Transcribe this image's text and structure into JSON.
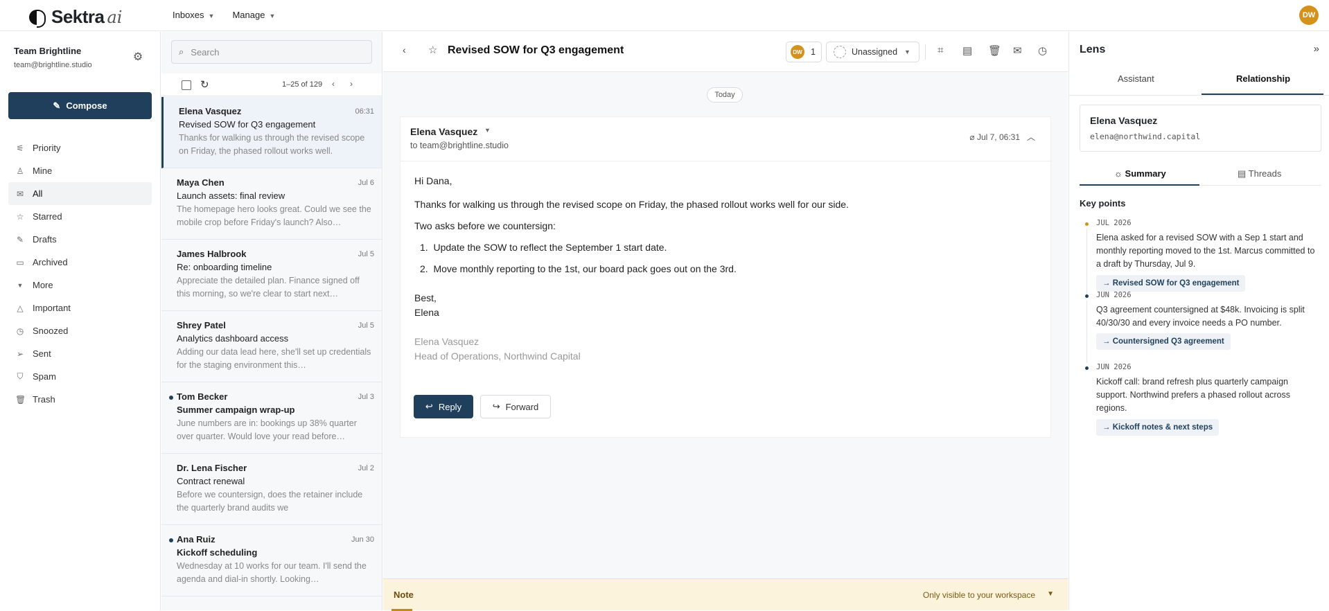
{
  "app": {
    "name": "Sektra",
    "suffix": "ai",
    "avatar_initials": "DW"
  },
  "topnav": [
    {
      "label": "Inboxes"
    },
    {
      "label": "Manage"
    }
  ],
  "sidebar": {
    "team_name": "Team Brightline",
    "team_email": "team@brightline.studio",
    "compose_label": "Compose",
    "items": [
      {
        "label": "Priority",
        "icon": "priority-icon"
      },
      {
        "label": "Mine",
        "icon": "user-icon"
      },
      {
        "label": "All",
        "icon": "mail-icon"
      },
      {
        "label": "Starred",
        "icon": "star-icon"
      },
      {
        "label": "Drafts",
        "icon": "pencil-icon"
      },
      {
        "label": "Archived",
        "icon": "archive-icon"
      }
    ],
    "more_label": "More",
    "more_items": [
      {
        "label": "Important",
        "icon": "important-icon"
      },
      {
        "label": "Snoozed",
        "icon": "clock-icon"
      },
      {
        "label": "Sent",
        "icon": "send-icon"
      },
      {
        "label": "Spam",
        "icon": "shield-icon"
      },
      {
        "label": "Trash",
        "icon": "trash-icon"
      }
    ]
  },
  "list": {
    "search_placeholder": "Search",
    "count": "1–25 of 129",
    "messages": [
      {
        "from": "Elena Vasquez",
        "date": "06:31",
        "subject": "Revised SOW for Q3 engagement",
        "preview": "Thanks for walking us through the revised scope on Friday, the phased rollout works well.",
        "selected": true,
        "unread": false
      },
      {
        "from": "Maya Chen",
        "date": "Jul 6",
        "subject": "Launch assets: final review",
        "preview": "The homepage hero looks great. Could we see the mobile crop before Friday's launch? Also…",
        "selected": false,
        "unread": false
      },
      {
        "from": "James Halbrook",
        "date": "Jul 5",
        "subject": "Re: onboarding timeline",
        "preview": "Appreciate the detailed plan. Finance signed off this morning, so we're clear to start next…",
        "selected": false,
        "unread": false
      },
      {
        "from": "Shrey Patel",
        "date": "Jul 5",
        "subject": "Analytics dashboard access",
        "preview": "Adding our data lead here, she'll set up credentials for the staging environment this…",
        "selected": false,
        "unread": false
      },
      {
        "from": "Tom Becker",
        "date": "Jul 3",
        "subject": "Summer campaign wrap-up",
        "preview": "June numbers are in: bookings up 38% quarter over quarter. Would love your read before…",
        "selected": false,
        "unread": true
      },
      {
        "from": "Dr. Lena Fischer",
        "date": "Jul 2",
        "subject": "Contract renewal",
        "preview": "Before we countersign, does the retainer include the quarterly brand audits we",
        "selected": false,
        "unread": false
      },
      {
        "from": "Ana Ruiz",
        "date": "Jun 30",
        "subject": "Kickoff scheduling",
        "preview": "Wednesday at 10 works for our team. I'll send the agenda and dial-in shortly. Looking…",
        "selected": false,
        "unread": true
      }
    ]
  },
  "thread": {
    "title": "Revised SOW for Q3 engagement",
    "assignee_count": "1",
    "assign_label": "Unassigned",
    "day_label": "Today",
    "sender": "Elena Vasquez",
    "to": "to team@brightline.studio",
    "when": "Jul 7, 06:31",
    "body": {
      "greeting": "Hi Dana,",
      "p1": "Thanks for walking us through the revised scope on Friday, the phased rollout works well for our side.",
      "p2": "Two asks before we countersign:",
      "item1": "Update the SOW to reflect the September 1 start date.",
      "item2": "Move monthly reporting to the 1st, our board pack goes out on the 3rd.",
      "closing": "Best,",
      "name": "Elena",
      "sig_name": "Elena Vasquez",
      "sig_title": "Head of Operations, Northwind Capital"
    },
    "reply_label": "Reply",
    "forward_label": "Forward",
    "note_title": "Note",
    "note_visibility": "Only visible to your workspace"
  },
  "lens": {
    "title": "Lens",
    "tabs": [
      "Assistant",
      "Relationship"
    ],
    "contact_name": "Elena Vasquez",
    "contact_email": "elena@northwind.capital",
    "subtabs": [
      "Summary",
      "Threads"
    ],
    "key_points_title": "Key points",
    "key_points": [
      {
        "date": "JUL 2026",
        "text": "Elena asked for a revised SOW with a Sep 1 start and monthly reporting moved to the 1st. Marcus committed to a draft by Thursday, Jul 9.",
        "link": "→ Revised SOW for Q3 engagement"
      },
      {
        "date": "JUN 2026",
        "text": "Q3 agreement countersigned at $48k. Invoicing is split 40/30/30 and every invoice needs a PO number.",
        "link": "→ Countersigned Q3 agreement"
      },
      {
        "date": "JUN 2026",
        "text": "Kickoff call: brand refresh plus quarterly campaign support. Northwind prefers a phased rollout across regions.",
        "link": "→ Kickoff notes & next steps"
      }
    ]
  },
  "colors": {
    "accent": "#1f3f5c",
    "avatar": "#d4911c",
    "note_bg": "#fbf3dc"
  }
}
